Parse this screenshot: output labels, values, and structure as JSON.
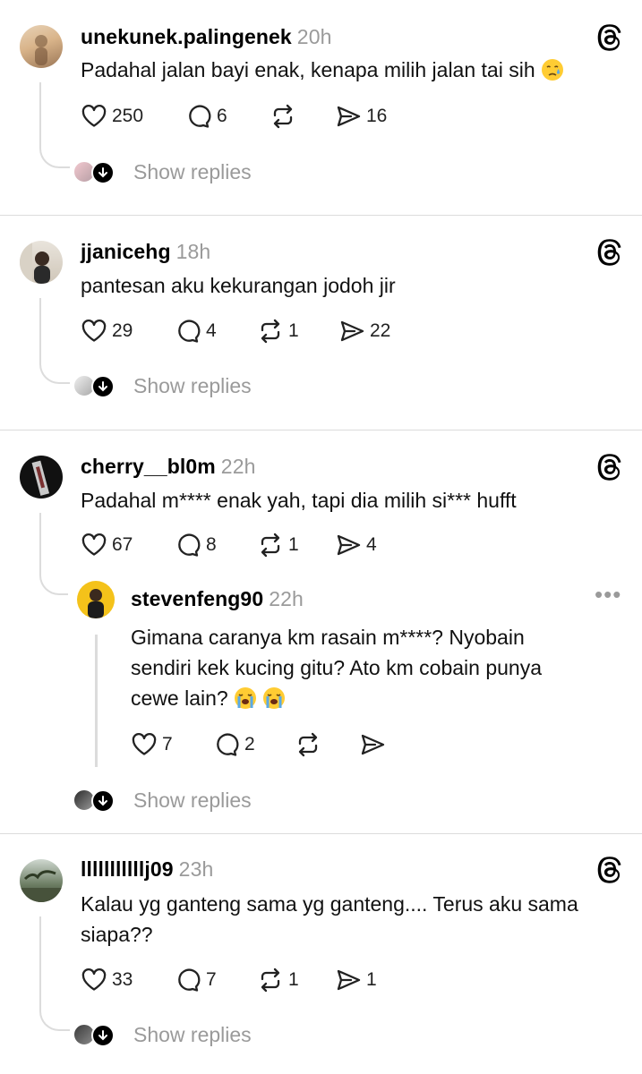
{
  "show_replies_label": "Show replies",
  "posts": [
    {
      "username": "unekunek.palingenek",
      "time": "20h",
      "text": "Padahal jalan bayi enak, kenapa milih jalan tai sih",
      "emoji": "crying-face",
      "likes": "250",
      "comments": "6",
      "reposts": "",
      "shares": "16"
    },
    {
      "username": "jjanicehg",
      "time": "18h",
      "text": "pantesan aku kekurangan jodoh jir",
      "likes": "29",
      "comments": "4",
      "reposts": "1",
      "shares": "22"
    },
    {
      "username": "cherry__bl0m",
      "time": "22h",
      "text": "Padahal m**** enak yah, tapi dia milih si*** hufft",
      "likes": "67",
      "comments": "8",
      "reposts": "1",
      "shares": "4",
      "reply": {
        "username": "stevenfeng90",
        "time": "22h",
        "text_lines": [
          "Gimana caranya km rasain m****? Nyobain",
          "sendiri kek kucing gitu? Ato km cobain punya",
          "cewe lain?"
        ],
        "emoji": "loudly-crying-face",
        "likes": "7",
        "comments": "2",
        "reposts": "",
        "shares": ""
      }
    },
    {
      "username": "lllllllllllj09",
      "time": "23h",
      "text_lines": [
        "Kalau yg ganteng sama yg ganteng.... Terus aku sama",
        "siapa??"
      ],
      "likes": "33",
      "comments": "7",
      "reposts": "1",
      "shares": "1"
    }
  ]
}
